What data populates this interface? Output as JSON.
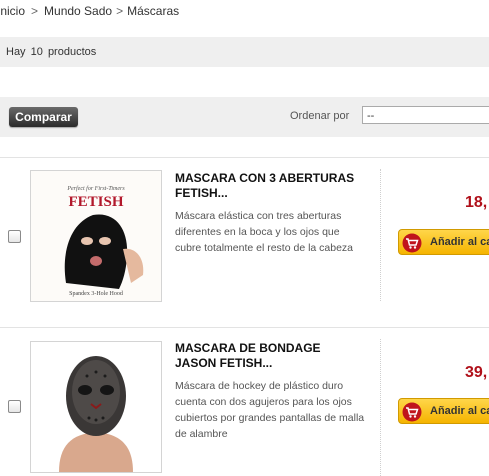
{
  "breadcrumb": {
    "home": "Inicio",
    "sep": ">",
    "category": "Mundo Sado",
    "current": "Máscaras"
  },
  "listing": {
    "count_prefix": "Hay",
    "count": "10",
    "count_suffix": "productos"
  },
  "toolbar": {
    "compare_label": "Comparar",
    "sort_label": "Ordenar por",
    "sort_value": "--"
  },
  "products": [
    {
      "title_line1": "MASCARA CON 3 ABERTURAS",
      "title_line2": "FETISH...",
      "desc_lines": [
        "Máscara elástica con tres aberturas",
        "diferentes en la boca y los ojos que",
        "cubre totalmente el resto de la cabeza"
      ],
      "price": "18,",
      "cart_label": "Añadir al ca",
      "image_text_top": "Perfect for First-Timers",
      "image_brand": "FETISH",
      "image_caption": "Spandex 3-Hole Hood"
    },
    {
      "title_line1": "MASCARA DE BONDAGE",
      "title_line2": "JASON FETISH...",
      "desc_lines": [
        "Máscara de hockey de plástico duro",
        "cuenta con dos agujeros para los ojos",
        "cubiertos por grandes pantallas de malla",
        "de alambre"
      ],
      "price": "39,",
      "cart_label": "Añadir al ca"
    }
  ],
  "colors": {
    "price": "#b0101a",
    "cart_button": "#f5b400",
    "compare_button": "#2b2b2b"
  }
}
